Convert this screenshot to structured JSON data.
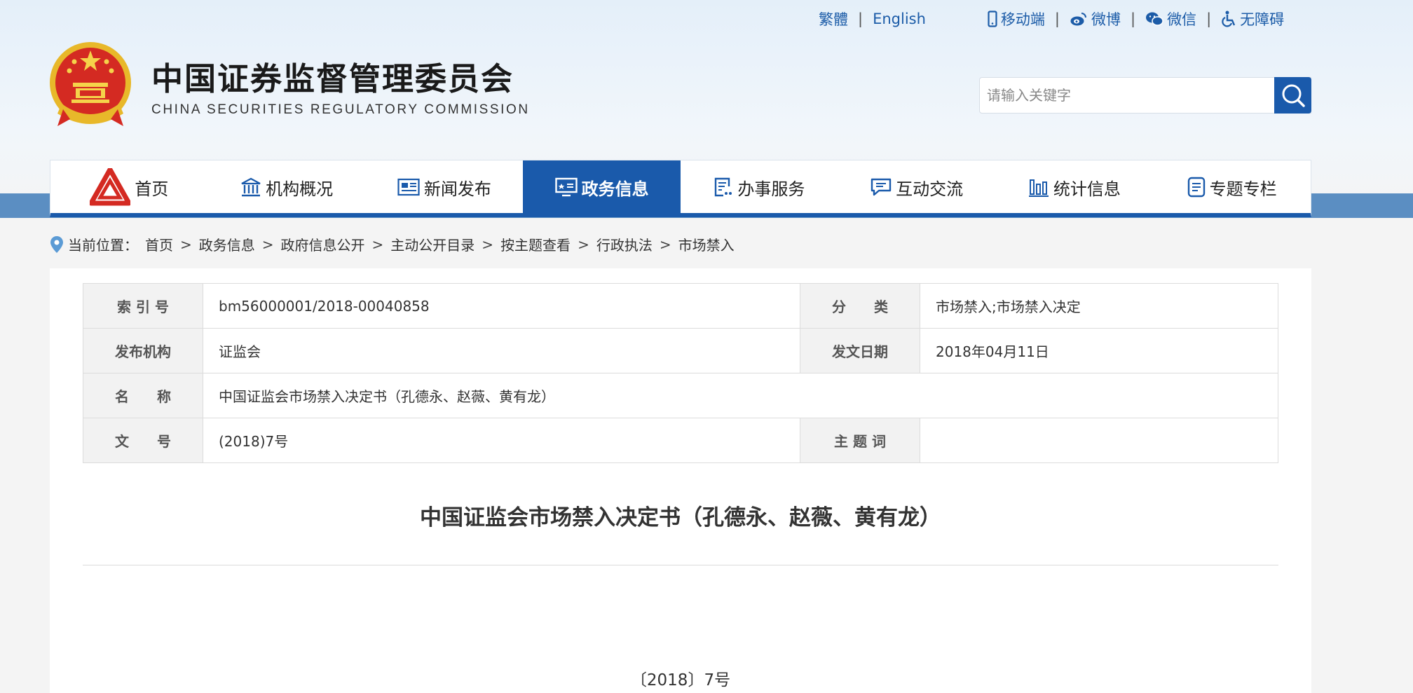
{
  "top_links": {
    "traditional": "繁體",
    "english": "English",
    "mobile": "移动端",
    "weibo": "微博",
    "wechat": "微信",
    "accessibility": "无障碍"
  },
  "site": {
    "title": "中国证券监督管理委员会",
    "subtitle": "CHINA SECURITIES REGULATORY COMMISSION"
  },
  "search": {
    "placeholder": "请输入关键字"
  },
  "nav": {
    "home": "首页",
    "about": "机构概况",
    "news": "新闻发布",
    "gov_info": "政务信息",
    "services": "办事服务",
    "interaction": "互动交流",
    "statistics": "统计信息",
    "topics": "专题专栏"
  },
  "breadcrumb": {
    "label": "当前位置：",
    "items": [
      "首页",
      "政务信息",
      "政府信息公开",
      "主动公开目录",
      "按主题查看",
      "行政执法",
      "市场禁入"
    ]
  },
  "meta": {
    "index_label": "索 引 号",
    "index_value": "bm56000001/2018-00040858",
    "category_label": "分　　类",
    "category_value": "市场禁入;市场禁入决定",
    "publisher_label": "发布机构",
    "publisher_value": "证监会",
    "date_label": "发文日期",
    "date_value": "2018年04月11日",
    "name_label": "名　　称",
    "name_value": "中国证监会市场禁入决定书（孔德永、赵薇、黄有龙）",
    "docno_label": "文　　号",
    "docno_value": "(2018)7号",
    "keywords_label": "主 题 词",
    "keywords_value": ""
  },
  "document": {
    "title": "中国证监会市场禁入决定书（孔德永、赵薇、黄有龙）",
    "number": "〔2018〕7号"
  },
  "colors": {
    "brand_blue": "#1a5aab",
    "band_blue": "#5b8ec2",
    "link_blue": "#1c5ca8"
  }
}
